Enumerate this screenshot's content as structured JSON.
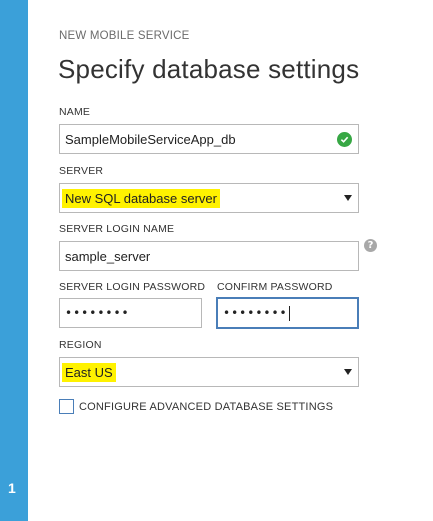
{
  "header": {
    "subtitle": "NEW MOBILE SERVICE",
    "title": "Specify database settings"
  },
  "name": {
    "label": "NAME",
    "value": "SampleMobileServiceApp_db",
    "status_icon": "valid-check-icon"
  },
  "server": {
    "label": "SERVER",
    "selected": "New SQL database server",
    "highlighted": true
  },
  "server_login_name": {
    "label": "SERVER LOGIN NAME",
    "value": "sample_server",
    "help_icon_glyph": "?"
  },
  "server_login_password": {
    "label": "SERVER LOGIN PASSWORD",
    "masked_value": "••••••••"
  },
  "confirm_password": {
    "label": "CONFIRM PASSWORD",
    "masked_value": "••••••••"
  },
  "region": {
    "label": "REGION",
    "selected": "East US",
    "highlighted": true
  },
  "advanced_settings": {
    "label": "CONFIGURE ADVANCED DATABASE SETTINGS",
    "checked": false
  },
  "wizard": {
    "step_number": "1"
  },
  "colors": {
    "rail": "#3ba0d9",
    "highlight": "#fff200",
    "valid": "#37a744",
    "focus_border": "#4a7eb8"
  }
}
